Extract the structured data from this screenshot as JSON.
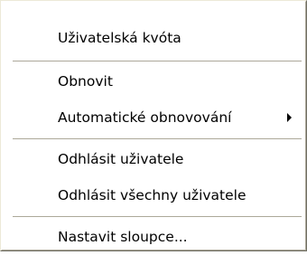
{
  "menu": {
    "items": [
      {
        "label": "Uživatelská kvóta"
      },
      {
        "label": "Obnovit"
      },
      {
        "label": "Automatické obnovování",
        "submenu_icon": "triangle-right-icon"
      },
      {
        "label": "Odhlásit uživatele"
      },
      {
        "label": "Odhlásit všechny uživatele"
      },
      {
        "label": "Nastavit sloupce..."
      }
    ]
  },
  "colors": {
    "background": "#ffffff",
    "separator_shadow": "#aca899",
    "separator_highlight": "#ffffff",
    "text": "#000000"
  }
}
